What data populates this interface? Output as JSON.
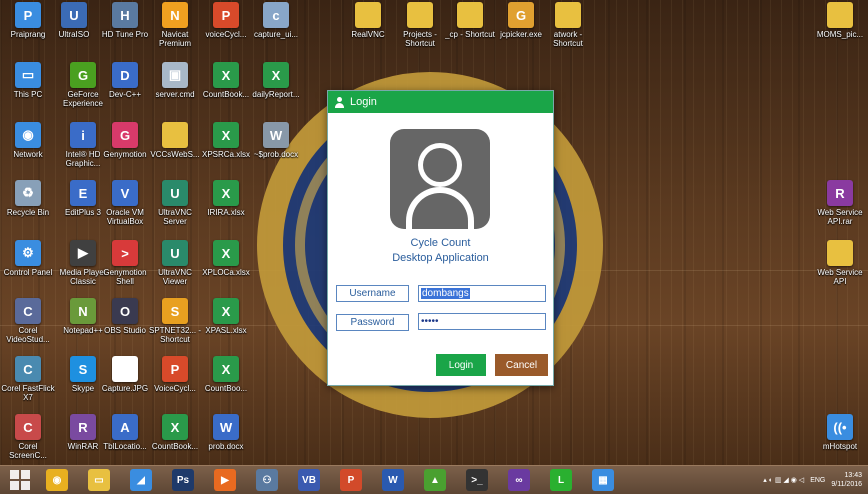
{
  "desktop": {
    "icons": [
      {
        "label": "Praiprang",
        "color": "#3a8de0",
        "glyph": "P"
      },
      {
        "label": "UltraISO",
        "color": "#3b6bb5",
        "glyph": "U"
      },
      {
        "label": "HD Tune Pro",
        "color": "#5a7aa0",
        "glyph": "H"
      },
      {
        "label": "Navicat Premium",
        "color": "#f0a020",
        "glyph": "N"
      },
      {
        "label": "voiceCycl...",
        "color": "#d84a2a",
        "glyph": "P"
      },
      {
        "label": "capture_ui...",
        "color": "#88a6c8",
        "glyph": "c"
      },
      {
        "label": "RealVNC",
        "color": "#e8c040",
        "glyph": ""
      },
      {
        "label": "Projects - Shortcut",
        "color": "#e8c040",
        "glyph": ""
      },
      {
        "label": "_cp - Shortcut",
        "color": "#e8c040",
        "glyph": ""
      },
      {
        "label": "jcpicker.exe",
        "color": "#e0a030",
        "glyph": "G"
      },
      {
        "label": "atwork - Shortcut",
        "color": "#e8c040",
        "glyph": ""
      },
      {
        "label": "MOMS_pic...",
        "color": "#e8c040",
        "glyph": ""
      },
      {
        "label": "This PC",
        "color": "#3a8de0",
        "glyph": "▭"
      },
      {
        "label": "GeForce Experience",
        "color": "#4aa020",
        "glyph": "G"
      },
      {
        "label": "Dev-C++",
        "color": "#3a6cc8",
        "glyph": "D"
      },
      {
        "label": "server.cmd",
        "color": "#a8b8c8",
        "glyph": "▣"
      },
      {
        "label": "CountBook...",
        "color": "#2a9a4a",
        "glyph": "X"
      },
      {
        "label": "dailyReport...",
        "color": "#2a9a4a",
        "glyph": "X"
      },
      {
        "label": "Network",
        "color": "#3a8de0",
        "glyph": "◉"
      },
      {
        "label": "Intel® HD Graphic...",
        "color": "#3a6cc8",
        "glyph": "i"
      },
      {
        "label": "Genymotion",
        "color": "#d83a6a",
        "glyph": "G"
      },
      {
        "label": "VCCsWebS...",
        "color": "#e8c040",
        "glyph": ""
      },
      {
        "label": "XPSRCa.xlsx",
        "color": "#2a9a4a",
        "glyph": "X"
      },
      {
        "label": "~$prob.docx",
        "color": "#8898a8",
        "glyph": "W"
      },
      {
        "label": "Recycle Bin",
        "color": "#88a0b8",
        "glyph": "♻"
      },
      {
        "label": "EditPlus 3",
        "color": "#3a6cc8",
        "glyph": "E"
      },
      {
        "label": "Oracle VM VirtualBox",
        "color": "#3a6cc8",
        "glyph": "V"
      },
      {
        "label": "UltraVNC Server",
        "color": "#2a8a6a",
        "glyph": "U"
      },
      {
        "label": "IRIRA.xlsx",
        "color": "#2a9a4a",
        "glyph": "X"
      },
      {
        "label": "Web Service API.rar",
        "color": "#8a3aa0",
        "glyph": "R"
      },
      {
        "label": "Control Panel",
        "color": "#3a8de0",
        "glyph": "⚙"
      },
      {
        "label": "Media Player Classic",
        "color": "#404040",
        "glyph": "▶"
      },
      {
        "label": "Genymotion Shell",
        "color": "#d83a3a",
        "glyph": ">"
      },
      {
        "label": "UltraVNC Viewer",
        "color": "#2a8a6a",
        "glyph": "U"
      },
      {
        "label": "XPLOCa.xlsx",
        "color": "#2a9a4a",
        "glyph": "X"
      },
      {
        "label": "Web Service API",
        "color": "#e8c040",
        "glyph": ""
      },
      {
        "label": "Corel VideoStud...",
        "color": "#5a6a9a",
        "glyph": "C"
      },
      {
        "label": "Notepad++",
        "color": "#6a9a3a",
        "glyph": "N"
      },
      {
        "label": "OBS Studio",
        "color": "#3a3a50",
        "glyph": "O"
      },
      {
        "label": "SPTNET32... - Shortcut",
        "color": "#e8a020",
        "glyph": "S"
      },
      {
        "label": "XPASL.xlsx",
        "color": "#2a9a4a",
        "glyph": "X"
      },
      {
        "label": "Corel FastFlick X7",
        "color": "#4a8ab0",
        "glyph": "C"
      },
      {
        "label": "Skype",
        "color": "#1e90e0",
        "glyph": "S"
      },
      {
        "label": "Capture.JPG",
        "color": "#ffffff",
        "glyph": ""
      },
      {
        "label": "VoiceCycl...",
        "color": "#d84a2a",
        "glyph": "P"
      },
      {
        "label": "CountBoo...",
        "color": "#2a9a4a",
        "glyph": "X"
      },
      {
        "label": "Corel ScreenC...",
        "color": "#c84a4a",
        "glyph": "C"
      },
      {
        "label": "WinRAR",
        "color": "#7a4aa0",
        "glyph": "R"
      },
      {
        "label": "TblLocatio...",
        "color": "#3a6cc8",
        "glyph": "A"
      },
      {
        "label": "CountBook...",
        "color": "#2a9a4a",
        "glyph": "X"
      },
      {
        "label": "prob.docx",
        "color": "#3a6cc8",
        "glyph": "W"
      },
      {
        "label": "mHotspot",
        "color": "#3a8de0",
        "glyph": "((•"
      }
    ]
  },
  "dialog": {
    "title": "Login",
    "app_title_line1": "Cycle Count",
    "app_title_line2": "Desktop Application",
    "username_label": "Username",
    "username_value": "dombangs",
    "password_label": "Password",
    "password_value": "•••••",
    "login_button": "Login",
    "cancel_button": "Cancel",
    "login_color": "#1aa548",
    "cancel_color": "#9a5a2a"
  },
  "taskbar": {
    "apps": [
      {
        "name": "chrome-icon",
        "color": "#e8b020",
        "glyph": "◉"
      },
      {
        "name": "explorer-icon",
        "color": "#e8c040",
        "glyph": "▭"
      },
      {
        "name": "app-icon",
        "color": "#3a8de0",
        "glyph": "◢"
      },
      {
        "name": "photoshop-icon",
        "color": "#1e3a6a",
        "glyph": "Ps"
      },
      {
        "name": "media-icon",
        "color": "#e86a20",
        "glyph": "▶"
      },
      {
        "name": "people-icon",
        "color": "#5a7aa0",
        "glyph": "⚇"
      },
      {
        "name": "vb-icon",
        "color": "#3a5ab0",
        "glyph": "VB"
      },
      {
        "name": "powerpoint-icon",
        "color": "#d24a2a",
        "glyph": "P"
      },
      {
        "name": "word-icon",
        "color": "#2a5ab0",
        "glyph": "W"
      },
      {
        "name": "photo-icon",
        "color": "#4aa030",
        "glyph": "▲"
      },
      {
        "name": "terminal-icon",
        "color": "#333333",
        "glyph": ">_"
      },
      {
        "name": "visual-studio-icon",
        "color": "#6a3aa0",
        "glyph": "∞"
      },
      {
        "name": "line-icon",
        "color": "#2ab030",
        "glyph": "L"
      },
      {
        "name": "windows-app-icon",
        "color": "#3a8de0",
        "glyph": "▦"
      }
    ],
    "language": "ENG",
    "time": "13:43",
    "date": "9/11/2016"
  }
}
